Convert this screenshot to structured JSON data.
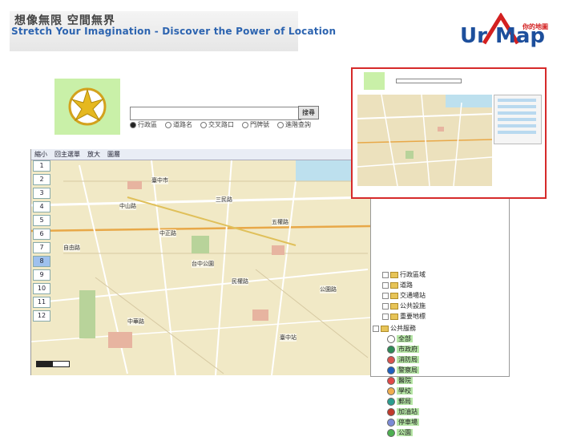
{
  "banner": {
    "slogan_zh": "想像無限 空間無界",
    "slogan_en": "Stretch Your Imagination - Discover the Power of Location"
  },
  "logo": {
    "text_ur": "Ur",
    "text_map": "Map",
    "tagline": "你的地圖"
  },
  "colors": {
    "inset_border": "#d62a2a",
    "map_bg": "#f1e9c6",
    "layer_label_bg": "#b6e6a6",
    "brand_blue": "#1d4f9c"
  },
  "search": {
    "value": "",
    "button_label": "搜尋"
  },
  "search_modes": [
    {
      "label": "行政區",
      "selected": true
    },
    {
      "label": "道路名",
      "selected": false
    },
    {
      "label": "交叉路口",
      "selected": false
    },
    {
      "label": "門牌號",
      "selected": false
    },
    {
      "label": "進階查詢",
      "selected": false
    }
  ],
  "map_toolbar": [
    "縮小",
    "回主選單",
    "放大",
    "圖層"
  ],
  "zoom_levels": [
    "1",
    "2",
    "3",
    "4",
    "5",
    "6",
    "7",
    "8",
    "9",
    "10",
    "11",
    "12"
  ],
  "selected_zoom_index": 7,
  "map_labels": [
    "臺中市",
    "中山路",
    "中正路",
    "五權路",
    "三民路",
    "自由路",
    "公園路",
    "民權路",
    "中華路",
    "台中公園",
    "臺中站"
  ],
  "tree": {
    "folders": [
      "行政區域",
      "道路",
      "交通場站",
      "公共設施",
      "重要地標"
    ],
    "group": "公共服務",
    "layers": [
      {
        "label": "全部",
        "icon": "checkbox-icon"
      },
      {
        "label": "市政府",
        "icon": "government-icon"
      },
      {
        "label": "消防局",
        "icon": "fire-station-icon"
      },
      {
        "label": "警察局",
        "icon": "police-icon"
      },
      {
        "label": "醫院",
        "icon": "hospital-icon"
      },
      {
        "label": "學校",
        "icon": "school-icon"
      },
      {
        "label": "郵局",
        "icon": "post-office-icon"
      },
      {
        "label": "加油站",
        "icon": "gas-station-icon"
      },
      {
        "label": "停車場",
        "icon": "parking-icon"
      },
      {
        "label": "公園",
        "icon": "park-icon"
      }
    ]
  }
}
